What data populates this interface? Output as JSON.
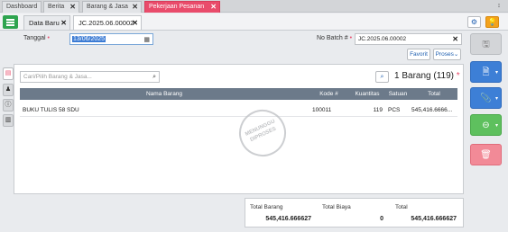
{
  "top_tabs": [
    {
      "label": "Dashboard"
    },
    {
      "label": "Berita"
    },
    {
      "label": "Barang & Jasa"
    },
    {
      "label": "Pekerjaan Pesanan"
    }
  ],
  "top_corner": "↕",
  "sub_tabs": [
    {
      "label": "Data Baru"
    },
    {
      "label": "JC.2025.06.00002"
    }
  ],
  "form": {
    "tanggal_label": "Tanggal",
    "tanggal_value": "13/06/2025",
    "batch_label": "No Batch #",
    "batch_value": "JC.2025.06.00002",
    "favorit": "Favorit",
    "proses": "Proses"
  },
  "search": {
    "placeholder": "Cari/Pilih Barang & Jasa...",
    "count_text": "1 Barang (119)"
  },
  "table": {
    "headers": [
      "Nama Barang",
      "Kode #",
      "Kuantitas",
      "Satuan",
      "Total"
    ],
    "rows": [
      {
        "nama": "BUKU TULIS 58 SDU",
        "kode": "100011",
        "qty": "119",
        "satuan": "PCS",
        "total": "545,416.6666..."
      }
    ]
  },
  "stamp": {
    "line1": "MENUNGGU",
    "line2": "DIPROSES"
  },
  "footer": {
    "total_barang_label": "Total Barang",
    "total_barang_value": "545,416.666627",
    "total_biaya_label": "Total Biaya",
    "total_biaya_value": "0",
    "total_label": "Total",
    "total_value": "545,416.666627"
  },
  "colors": {
    "accent": "#e94c6b",
    "primary": "#1e5fb0",
    "success": "#2ea44f",
    "warning": "#f3a21c"
  }
}
